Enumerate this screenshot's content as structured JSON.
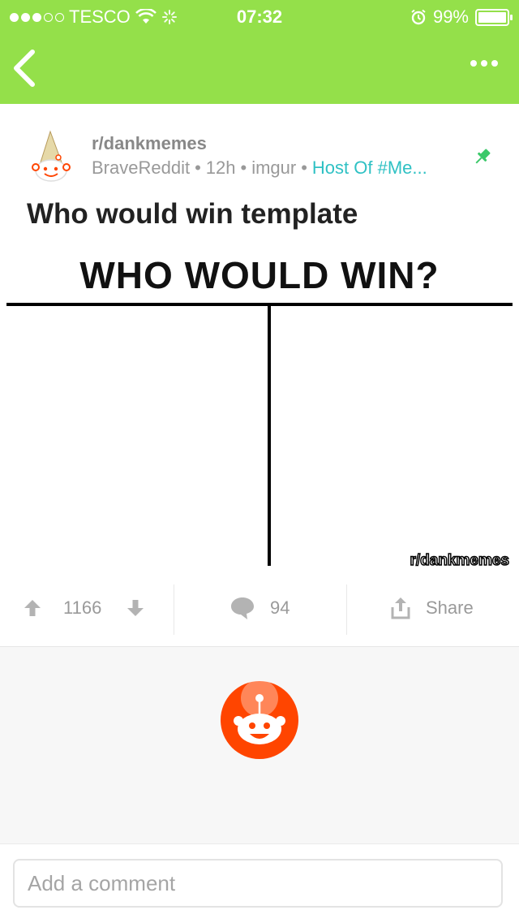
{
  "status_bar": {
    "carrier": "TESCO",
    "time": "07:32",
    "battery": "99%"
  },
  "post": {
    "subreddit": "r/dankmemes",
    "author": "BraveReddit",
    "age": "12h",
    "domain": "imgur",
    "flair": "Host Of #Me...",
    "title": "Who would win template",
    "image": {
      "headline": "WHO WOULD WIN?",
      "watermark": "r/dankmemes"
    },
    "score": "1166",
    "comment_count": "94",
    "share_label": "Share"
  },
  "comment_box": {
    "placeholder": "Add a comment"
  },
  "colors": {
    "header_green": "#94e04a",
    "flair_teal": "#2fc1c4",
    "reddit_orange": "#ff4500"
  },
  "icons": [
    "back-chevron-icon",
    "more-dots-icon",
    "wifi-icon",
    "alarm-icon",
    "pin-icon",
    "upvote-icon",
    "downvote-icon",
    "comment-icon",
    "share-icon",
    "snoo-icon"
  ]
}
